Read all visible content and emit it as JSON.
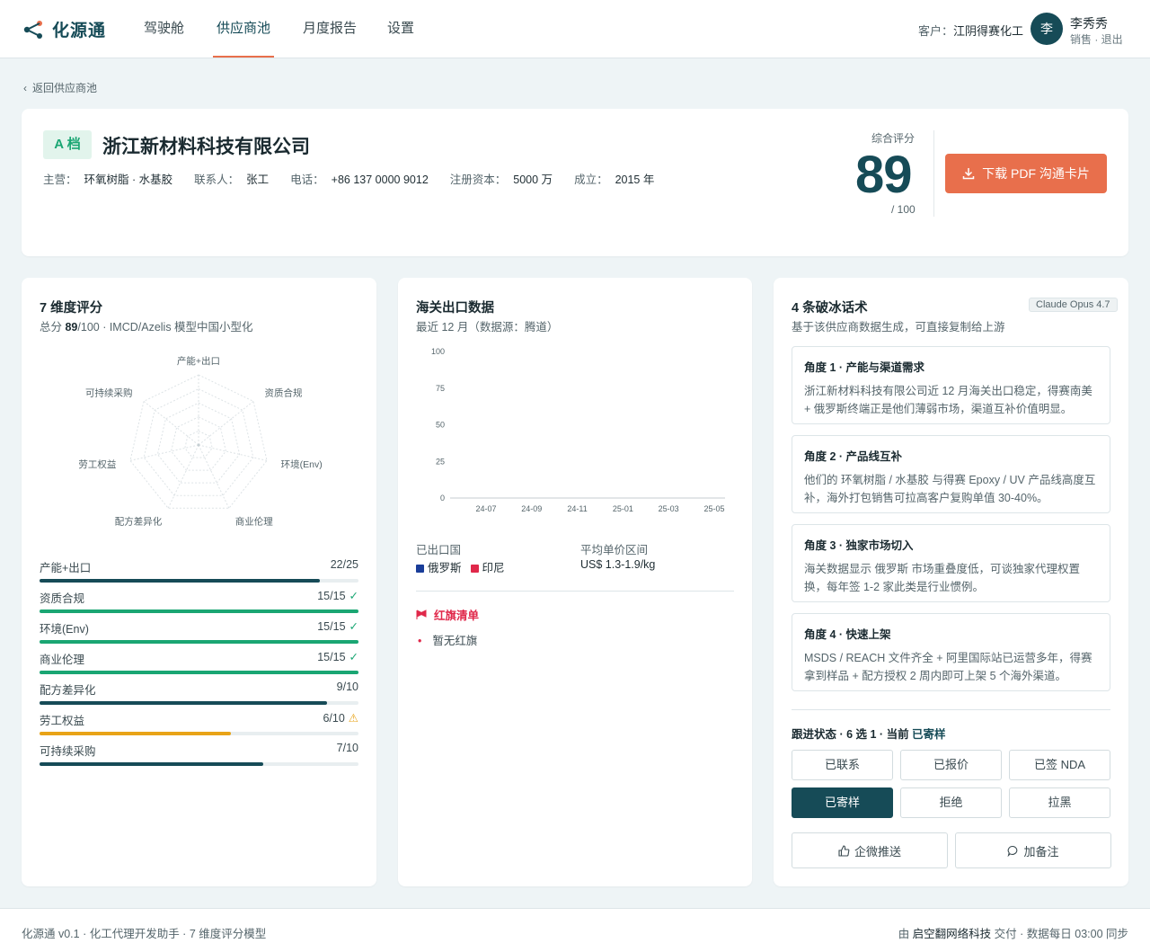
{
  "header": {
    "brand": "化源通",
    "nav": [
      "驾驶舱",
      "供应商池",
      "月度报告",
      "设置"
    ],
    "customer_label": "客户：",
    "customer_name": "江阴得赛化工",
    "avatar": "李",
    "user_name": "李秀秀",
    "user_role": "销售 · 退出"
  },
  "back_link": "返回供应商池",
  "company": {
    "grade": "A 档",
    "name": "浙江新材料科技有限公司",
    "main_label": "主营：",
    "main": "环氧树脂 · 水基胶",
    "contact_label": "联系人：",
    "contact": "张工",
    "phone_label": "电话：",
    "phone": "+86 137 0000 9012",
    "capital_label": "注册资本：",
    "capital": "5000 万",
    "founded_label": "成立：",
    "founded": "2015 年",
    "score_label": "综合评分",
    "score": "89",
    "score_max": "/ 100",
    "pdf_button": "下载 PDF 沟通卡片",
    "colors": {
      "accent": "#e86f4c",
      "brand": "#164b57",
      "grade": "#1aa673"
    }
  },
  "dimensions": {
    "title": "7 维度评分",
    "subtitle_prefix": "总分 ",
    "subtitle_score": "89",
    "subtitle_suffix": "/100 · IMCD/Azelis 模型中国小型化",
    "radar_labels": [
      "产能+出口",
      "资质合规",
      "环境(Env)",
      "商业伦理",
      "配方差异化",
      "劳工权益",
      "可持续采购"
    ],
    "items": [
      {
        "label": "产能+出口",
        "score": "22/25",
        "value": 22,
        "max": 25,
        "color": "#164b57",
        "mark": ""
      },
      {
        "label": "资质合规",
        "score": "15/15",
        "value": 15,
        "max": 15,
        "color": "#1aa673",
        "mark": "✓"
      },
      {
        "label": "环境(Env)",
        "score": "15/15",
        "value": 15,
        "max": 15,
        "color": "#1aa673",
        "mark": "✓"
      },
      {
        "label": "商业伦理",
        "score": "15/15",
        "value": 15,
        "max": 15,
        "color": "#1aa673",
        "mark": "✓"
      },
      {
        "label": "配方差异化",
        "score": "9/10",
        "value": 9,
        "max": 10,
        "color": "#164b57",
        "mark": ""
      },
      {
        "label": "劳工权益",
        "score": "6/10",
        "value": 6,
        "max": 10,
        "color": "#e8a317",
        "mark": "⚠"
      },
      {
        "label": "可持续采购",
        "score": "7/10",
        "value": 7,
        "max": 10,
        "color": "#164b57",
        "mark": ""
      }
    ]
  },
  "customs": {
    "title": "海关出口数据",
    "subtitle": "最近 12 月（数据源：腾道）",
    "chart_data": {
      "type": "line",
      "x": [
        "24-07",
        "24-09",
        "24-11",
        "25-01",
        "25-03",
        "25-05"
      ],
      "y_ticks": [
        "100",
        "75",
        "50",
        "25",
        "0"
      ],
      "ylim": [
        0,
        100
      ],
      "series": []
    },
    "countries_label": "已出口国",
    "countries": [
      {
        "name": "俄罗斯",
        "color": "#1a3d99"
      },
      {
        "name": "印尼",
        "color": "#e0284a"
      }
    ],
    "price_label": "平均单价区间",
    "price": "US$ 1.3-1.9/kg",
    "redflag_title": "红旗清单",
    "redflag_item": "暂无红旗"
  },
  "talks": {
    "title": "4 条破冰话术",
    "model": "Claude Opus 4.7",
    "subtitle": "基于该供应商数据生成，可直接复制给上游",
    "items": [
      {
        "title": "角度 1 · 产能与渠道需求",
        "text": "浙江新材料科技有限公司近 12 月海关出口稳定，得赛南美 + 俄罗斯终端正是他们薄弱市场，渠道互补价值明显。"
      },
      {
        "title": "角度 2 · 产品线互补",
        "text": "他们的 环氧树脂 / 水基胶 与得赛 Epoxy / UV 产品线高度互补，海外打包销售可拉高客户复购单值 30-40%。"
      },
      {
        "title": "角度 3 · 独家市场切入",
        "text": "海关数据显示 俄罗斯 市场重叠度低，可谈独家代理权置换，每年签 1-2 家此类是行业惯例。"
      },
      {
        "title": "角度 4 · 快速上架",
        "text": "MSDS / REACH 文件齐全 + 阿里国际站已运营多年，得赛拿到样品 + 配方授权 2 周内即可上架 5 个海外渠道。"
      }
    ],
    "status_title": "跟进状态 · 6 选 1 · 当前 ",
    "status_current": "已寄样",
    "statuses": [
      "已联系",
      "已报价",
      "已签 NDA",
      "已寄样",
      "拒绝",
      "拉黑"
    ],
    "active_status_index": 3,
    "push_button": "企微推送",
    "note_button": "加备注"
  },
  "footer": {
    "left": "化源通 v0.1 · 化工代理开发助手 · 7 维度评分模型",
    "right_prefix": "由 ",
    "right_company": "启空翻网络科技",
    "right_suffix": " 交付 · 数据每日 03:00 同步"
  }
}
